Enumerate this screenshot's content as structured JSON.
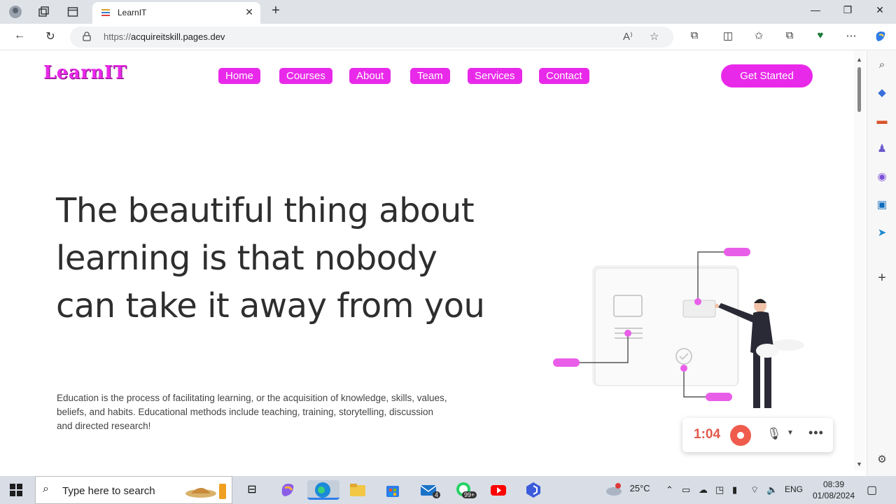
{
  "browser": {
    "tab_title": "LearnIT",
    "url_protocol": "https://",
    "url_host": "acquireitskill.pages.dev"
  },
  "site": {
    "logo": "LearnIT",
    "nav": [
      "Home",
      "Courses",
      "About",
      "Team",
      "Services",
      "Contact"
    ],
    "cta": "Get Started",
    "headline": "The beautiful thing about learning is that nobody can take it away from you",
    "subtext": "Education is the process of facilitating learning, or the acquisition of knowledge, skills, values, beliefs, and habits. Educational methods include teaching, training, storytelling, discussion and directed research!",
    "accent_color": "#e929e9"
  },
  "recorder": {
    "time": "1:04"
  },
  "taskbar": {
    "search_placeholder": "Type here to search",
    "weather": "25°C",
    "language": "ENG",
    "time": "08:39",
    "date": "01/08/2024",
    "mail_badge": "4",
    "whatsapp_badge": "99+"
  }
}
